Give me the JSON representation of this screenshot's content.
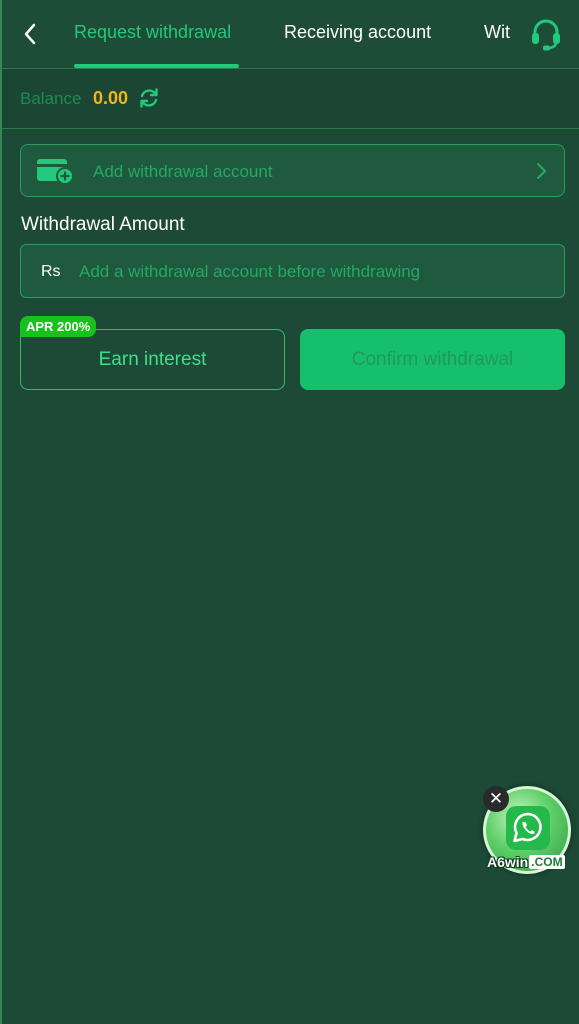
{
  "header": {
    "back_icon": "chevron-left-icon",
    "tabs": [
      {
        "label": "Request withdrawal",
        "active": true
      },
      {
        "label": "Receiving account",
        "active": false
      },
      {
        "label": "Wit",
        "active": false
      }
    ],
    "support_icon": "headset-icon"
  },
  "balance": {
    "label": "Balance",
    "value": "0.00",
    "refresh_icon": "refresh-icon"
  },
  "add_account": {
    "icon": "wallet-add-icon",
    "label": "Add withdrawal account",
    "chevron_icon": "chevron-right-icon"
  },
  "withdrawal": {
    "label": "Withdrawal Amount",
    "currency": "Rs",
    "placeholder": "Add a withdrawal account before withdrawing"
  },
  "actions": {
    "apr_badge": "APR 200%",
    "earn_label": "Earn interest",
    "confirm_label": "Confirm withdrawal"
  },
  "floating_widget": {
    "icon": "whatsapp-icon",
    "brand": "A6win",
    "brand_suffix": ".COM",
    "close_symbol": "✕"
  },
  "colors": {
    "background": "#1c4a36",
    "accent": "#22c97a",
    "balance_value": "#f3b51b",
    "confirm_button": "#16bf6c",
    "apr_badge": "#18c21c"
  }
}
